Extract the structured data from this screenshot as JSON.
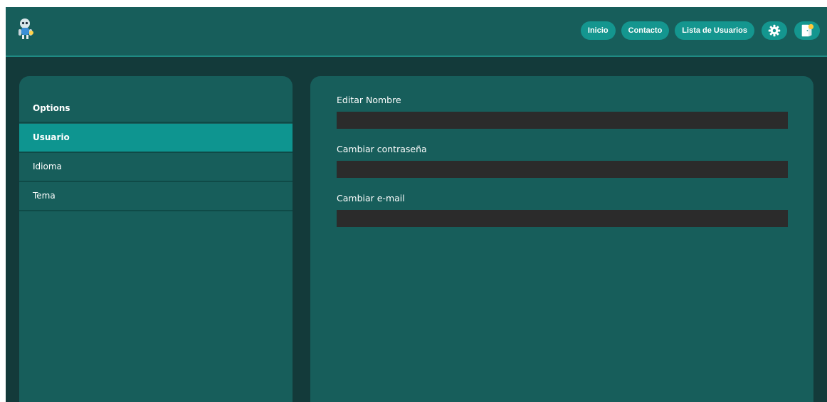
{
  "header": {
    "logo_icon": "robot-mascot-icon",
    "nav": [
      {
        "label": "Inicio"
      },
      {
        "label": "Contacto"
      },
      {
        "label": "Lista de Usuarios"
      }
    ],
    "settings_icon": "gear-icon",
    "logout_icon": "exit-door-icon"
  },
  "sidebar": {
    "heading": "Options",
    "items": [
      {
        "label": "Usuario",
        "active": true
      },
      {
        "label": "Idioma",
        "active": false
      },
      {
        "label": "Tema",
        "active": false
      }
    ]
  },
  "form": {
    "fields": [
      {
        "label": "Editar Nombre",
        "value": "",
        "placeholder": ""
      },
      {
        "label": "Cambiar contraseña",
        "value": "",
        "placeholder": ""
      },
      {
        "label": "Cambiar e-mail",
        "value": "",
        "placeholder": ""
      }
    ]
  },
  "colors": {
    "background": "#133a3a",
    "surface": "#175e5b",
    "accent": "#14968f",
    "active_item": "#0e9590",
    "input": "#2b2b2b",
    "text": "#ffffff"
  }
}
